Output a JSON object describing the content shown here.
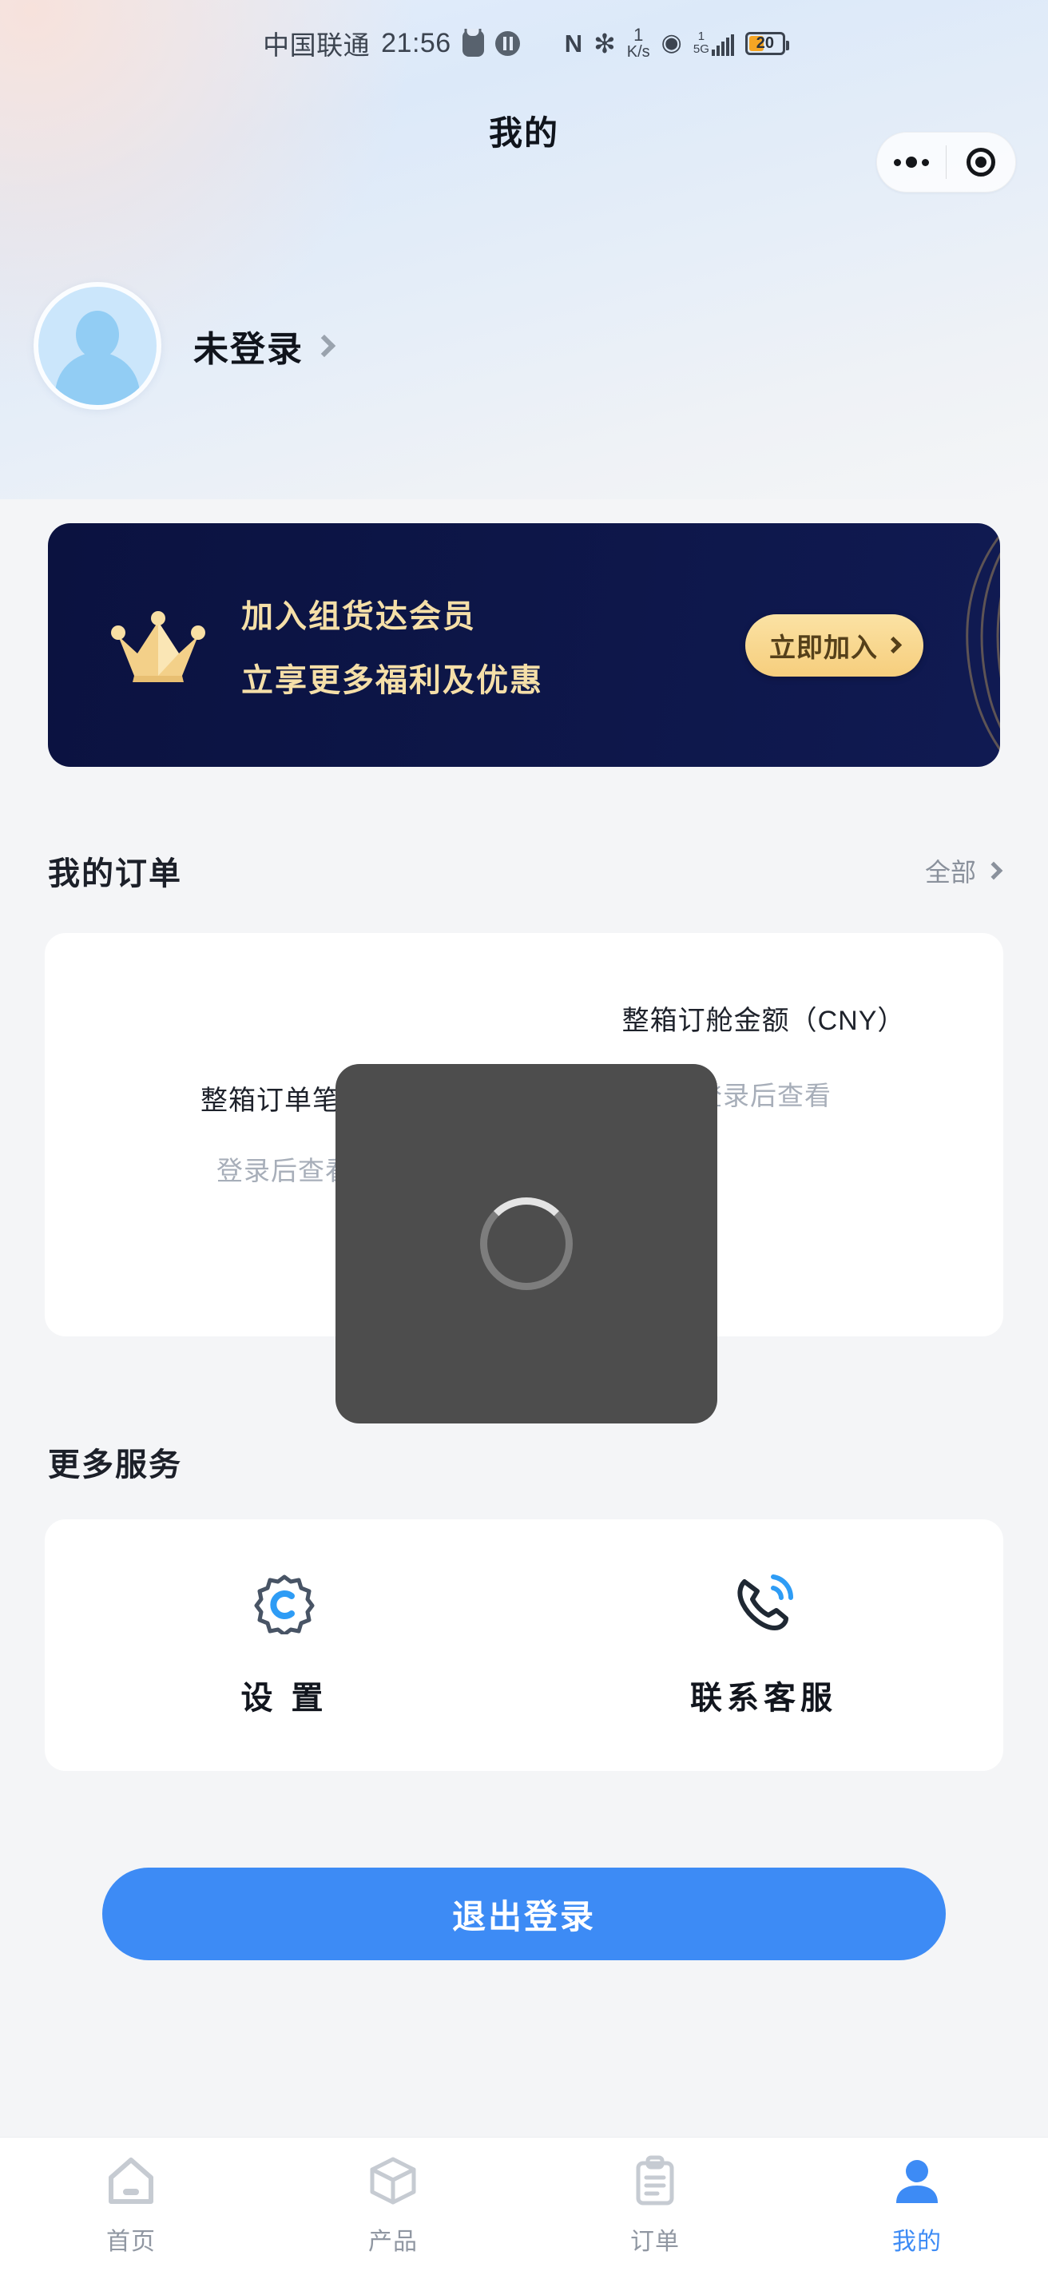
{
  "status_bar": {
    "carrier": "中国联通",
    "time": "21:56",
    "alarm_icon": "alarm-icon",
    "pause_icon": "pause-icon",
    "nfc_icon": "nfc-icon",
    "nfc_glyph": "N",
    "bluetooth_icon": "bluetooth-icon",
    "bluetooth_glyph": "✻",
    "net_speed_value": "1",
    "net_speed_unit": "K/s",
    "hotspot_icon": "hotspot-icon",
    "hotspot_glyph": "◉",
    "signal_top": "1",
    "signal_network": "5G",
    "signal_bars_icon": "signal-bars-icon",
    "battery_level": "20"
  },
  "navbar": {
    "title": "我的",
    "capsule": {
      "more_icon": "more-dots-icon",
      "close_icon": "close-target-icon"
    }
  },
  "profile": {
    "avatar_icon": "default-avatar-icon",
    "name": "未登录",
    "chevron_icon": "chevron-right-icon"
  },
  "member_banner": {
    "crown_icon": "crown-icon",
    "title": "加入组货达会员",
    "subtitle": "立享更多福利及优惠",
    "button_label": "立即加入",
    "button_chevron_icon": "chevron-right-icon",
    "bg_color": "#0b1240",
    "gold_color": "#f5dfa8"
  },
  "orders": {
    "section_title": "我的订单",
    "more_label": "全部",
    "more_chevron_icon": "chevron-right-icon",
    "stats": [
      {
        "label": "整箱订单笔数",
        "value": "登录后查看"
      },
      {
        "label": "整箱订舱金额（CNY）",
        "value": "登录后查看"
      }
    ]
  },
  "loading_overlay": {
    "spinner_icon": "loading-spinner-icon",
    "visible": true
  },
  "services": {
    "section_title": "更多服务",
    "items": [
      {
        "label": "设 置",
        "icon": "settings-badge-icon"
      },
      {
        "label": "联系客服",
        "icon": "phone-support-icon"
      }
    ]
  },
  "logout": {
    "label": "退出登录",
    "color": "#3d8bf5"
  },
  "tabbar": {
    "items": [
      {
        "label": "首页",
        "icon": "home-icon",
        "active": false
      },
      {
        "label": "产品",
        "icon": "cube-icon",
        "active": false
      },
      {
        "label": "订单",
        "icon": "clipboard-icon",
        "active": false
      },
      {
        "label": "我的",
        "icon": "person-icon",
        "active": true
      }
    ],
    "active_color": "#3d8bf5",
    "inactive_color": "#9097a2"
  }
}
